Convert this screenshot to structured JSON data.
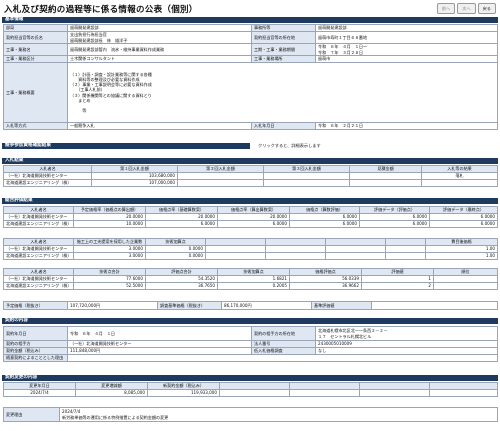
{
  "page_title": "入札及び契約の過程等に係る情報の公表（個別）",
  "buttons": [
    "前へ",
    "次へ",
    "戻る"
  ],
  "basic": {
    "header": "基本情報",
    "rows": [
      [
        "部局",
        "留萌開発建設部",
        "事務所等",
        "留萌開発建設部"
      ],
      [
        "契約担当官等の氏名",
        "支出負担行為担当官\n留萌開発建設部長　林　雄洋子",
        "契約担当官等の所在地",
        "留萌市寿町１丁目６８番地"
      ],
      [
        "工事・業務名",
        "留萌開発建設部管内　流氷・維持事業資料作成業務",
        "工期・工事・業務期間",
        "令和　６年　４月　１日～\n令和　７年　３月２８日"
      ],
      [
        "工事・業務区分",
        "土木関係コンサルタント",
        "工事・業務場所",
        "留萌市"
      ]
    ],
    "summary_label": "工事・業務概要",
    "summary": [
      "（１）計画・調査・設計業務等に関する各種",
      "　　資料等の整理及び必要な資料作成",
      "（２）事業・工事説明会等に必要な資料作成",
      "　　（工事人札前）",
      "（３）関係機関等との協議に関する資料とり",
      "　　まとめ",
      "",
      "　　　等"
    ],
    "method_label": "入札等方式",
    "method": "一般競争入札",
    "date_label": "入札年月日",
    "date": "令和　６年　２月２１日"
  },
  "competition": {
    "header": "競争参加資格確認結果",
    "note": "クリックすると、詳細表示します"
  },
  "bid": {
    "header": "入札結果",
    "cols": [
      "入札者名",
      "第１回入札金額",
      "第２回入札金額",
      "第３回入札金額",
      "見積金額",
      "入札等の結果"
    ],
    "rows": [
      [
        "（一社）北海道開発技術センター",
        "103,680,000",
        "",
        "",
        "",
        "落札"
      ],
      [
        "北海道建設エンジニアリング（株）",
        "107,000,000",
        "",
        "",
        "",
        ""
      ]
    ]
  },
  "eval": {
    "header": "総合評価結果",
    "cols1": [
      "入札者名",
      "予定価格率（価格点の算出額）",
      "価格点率（基礎算数案）",
      "価格点率（算出算数案）",
      "価格点（算数評価）",
      "評価データ（評価点）",
      "評価データ（最終点）"
    ],
    "rows1": [
      [
        "（一社）北海道開発技術センター",
        "20.0000",
        "20.0000",
        "20.0000",
        "6.0000",
        "6.0000",
        "6.0000"
      ],
      [
        "北海道建設エンジニアリング（株）",
        "10.0000",
        "6.0000",
        "6.0000",
        "6.0000",
        "6.0000",
        "6.0000"
      ]
    ],
    "cols2": [
      "入札者名",
      "施工上の工夫提案を採用した企業数",
      "技術加算点",
      "",
      "",
      "",
      "",
      "費目後価格"
    ],
    "rows2": [
      [
        "（一社）北海道開発技術センター",
        "3.0000",
        "0.0000",
        "",
        "",
        "",
        "",
        "1.00"
      ],
      [
        "北海道建設エンジニアリング（株）",
        "3.0000",
        "0.0000",
        "",
        "",
        "",
        "",
        "1.00"
      ]
    ],
    "cols3": [
      "入札者名",
      "技術点合計",
      "評価点合計",
      "技術加算点",
      "価格評価点",
      "評価値",
      "順位"
    ],
    "rows3": [
      [
        "（一社）北海道開発技術センター",
        "77.6000",
        "54.3520",
        "1.6821",
        "56.0339",
        "1"
      ],
      [
        "北海道建設エンジニアリング（株）",
        "52.5000",
        "36.7650",
        "0.2005",
        "36.9662",
        "2"
      ]
    ]
  },
  "prices": {
    "planned_label": "予定価格（税抜き）",
    "planned": "107,720,000円",
    "survey_label": "調査基準価格（税抜き）",
    "survey": "86,170,000円",
    "base_label": "基準評価値"
  },
  "contract": {
    "header": "契約の内容",
    "rows": [
      [
        "契約年月日",
        "令和　６年　４月　１日",
        "契約の相手方の所在地",
        "北海道札幌市北区北一一条西２－２－\n１７　セントラル札幌北ビル"
      ],
      [
        "契約の相手方",
        "（一社）北海道開発技術センター",
        "法人番号",
        "2430005010009"
      ],
      [
        "契約金額（税込み）",
        "111,848,000円",
        "低入札価格調査",
        "なし"
      ],
      [
        "随意契約によることとした理由",
        "",
        "",
        ""
      ]
    ]
  },
  "change": {
    "header": "契約変更の内容",
    "cols": [
      "変更年月日",
      "変更増減額",
      "新契約金額（税込み）",
      "",
      "",
      "",
      ""
    ],
    "row": [
      "2024/7/4",
      "8,085,000",
      "119,933,000",
      "",
      "",
      "",
      ""
    ],
    "reason_label": "変更理由",
    "reason": [
      "2024/7/4",
      "新労務単価等の運用に係る特例措置による契約金額の変更"
    ]
  }
}
